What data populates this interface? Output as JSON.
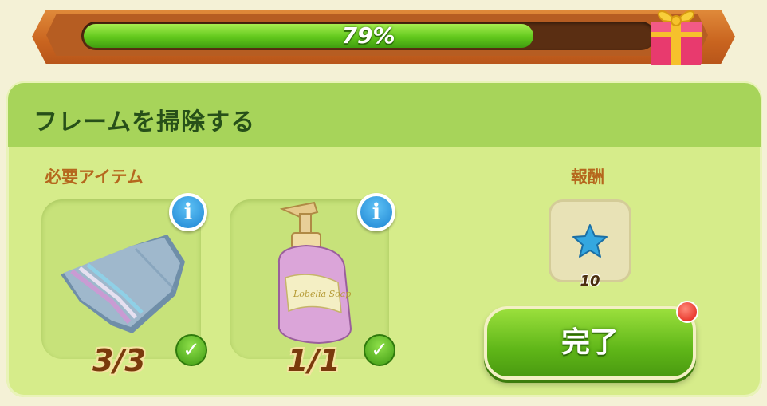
{
  "progress": {
    "value_percent": 79,
    "label": "79%"
  },
  "panel": {
    "title": "フレームを掃除する"
  },
  "required": {
    "heading": "必要アイテム",
    "items": [
      {
        "icon": "towel-icon",
        "count": "3/3",
        "complete": true
      },
      {
        "icon": "soap-bottle-icon",
        "bottle_text": "Lobelia Soap",
        "count": "1/1",
        "complete": true
      }
    ]
  },
  "reward": {
    "heading": "報酬",
    "icon": "blue-star-icon",
    "amount": "10"
  },
  "actions": {
    "done_label": "完了"
  },
  "colors": {
    "progress_fill": "#62c81c",
    "panel": "#d6ec8a",
    "title_bar": "#a7d45a",
    "accent_orange": "#b5671d"
  }
}
